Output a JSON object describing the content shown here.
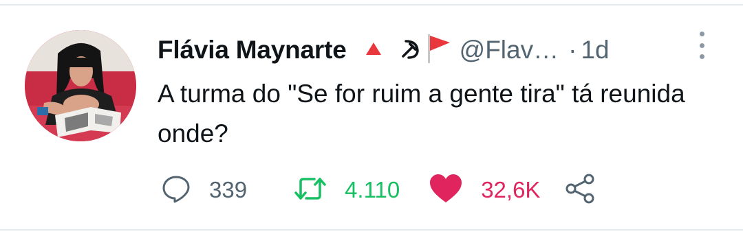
{
  "tweet": {
    "author_name": "Flávia Maynarte",
    "handle": "@Flav…",
    "separator": "·",
    "time": "1d",
    "text": "A turma do \"Se for ruim a gente tira\" tá reunida onde?",
    "emojis": [
      "red-triangle-icon",
      "hammer-sickle-icon",
      "red-flag-icon"
    ]
  },
  "actions": {
    "replies": "339",
    "retweets": "4.110",
    "likes": "32,6K"
  },
  "colors": {
    "text": "#0f1419",
    "secondary": "#536471",
    "retweet": "#17bf63",
    "like": "#e0245e",
    "divider": "#e6e9ec"
  }
}
